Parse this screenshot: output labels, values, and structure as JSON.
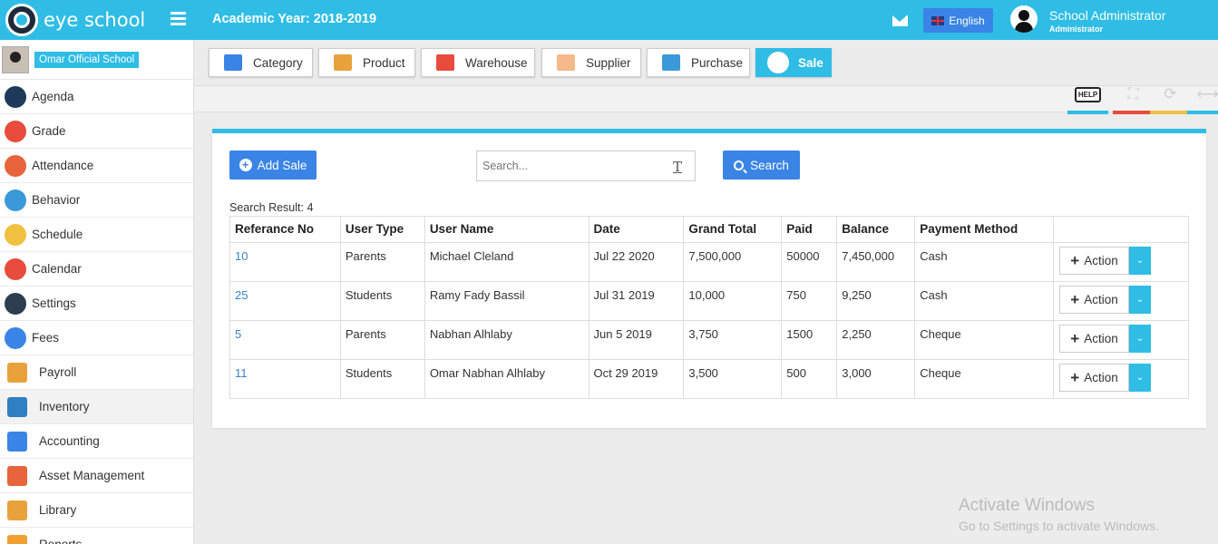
{
  "header": {
    "logo_text": "eye school",
    "academic_year": "Academic Year: 2018-2019",
    "language": "English",
    "user_name": "School Administrator",
    "user_role": "Administrator",
    "accent": "#2fbde6"
  },
  "sidebar": {
    "school_name": "Omar Official School",
    "items": [
      {
        "label": "Agenda",
        "icon": "agenda-icon",
        "color": "#1e3a5a"
      },
      {
        "label": "Grade",
        "icon": "grade-icon",
        "color": "#e74c3c"
      },
      {
        "label": "Attendance",
        "icon": "attendance-icon",
        "color": "#e8643c"
      },
      {
        "label": "Behavior",
        "icon": "behavior-icon",
        "color": "#3a9ad9"
      },
      {
        "label": "Schedule",
        "icon": "schedule-icon",
        "color": "#f0c040"
      },
      {
        "label": "Calendar",
        "icon": "calendar-icon",
        "color": "#e74c3c"
      },
      {
        "label": "Settings",
        "icon": "settings-icon",
        "color": "#2c3e50"
      },
      {
        "label": "Fees",
        "icon": "fees-icon",
        "color": "#3a84e6"
      },
      {
        "label": "Payroll",
        "icon": "payroll-icon",
        "color": "#e8a23c"
      },
      {
        "label": "Inventory",
        "icon": "inventory-icon",
        "color": "#2f7fc1"
      },
      {
        "label": "Accounting",
        "icon": "accounting-icon",
        "color": "#3a84e6"
      },
      {
        "label": "Asset Management",
        "icon": "asset-management-icon",
        "color": "#e8643c"
      },
      {
        "label": "Library",
        "icon": "library-icon",
        "color": "#e8a23c"
      },
      {
        "label": "Reports",
        "icon": "reports-icon",
        "color": "#f0a030"
      }
    ]
  },
  "tabs": [
    {
      "label": "Category",
      "icon": "category-icon",
      "color": "#3a84e6"
    },
    {
      "label": "Product",
      "icon": "product-icon",
      "color": "#e8a23c"
    },
    {
      "label": "Warehouse",
      "icon": "warehouse-icon",
      "color": "#e74c3c"
    },
    {
      "label": "Supplier",
      "icon": "supplier-icon",
      "color": "#f5b98a"
    },
    {
      "label": "Purchase",
      "icon": "purchase-icon",
      "color": "#3a9ad9"
    },
    {
      "label": "Sale",
      "icon": "sale-icon",
      "color": "#ffffff"
    }
  ],
  "tools": {
    "help": "HELP",
    "colors": [
      "#2fbde6",
      "#e74c3c",
      "#f0c040",
      "#2fbde6"
    ]
  },
  "main": {
    "add_button": "Add Sale",
    "search_placeholder": "Search...",
    "search_button": "Search",
    "result_text": "Search Result: 4",
    "columns": [
      "Referance No",
      "User Type",
      "User Name",
      "Date",
      "Grand Total",
      "Paid",
      "Balance",
      "Payment Method",
      ""
    ],
    "rows": [
      [
        "10",
        "Parents",
        "Michael Cleland",
        "Jul 22 2020",
        "7,500,000",
        "50000",
        "7,450,000",
        "Cash"
      ],
      [
        "25",
        "Students",
        "Ramy Fady Bassil",
        "Jul 31 2019",
        "10,000",
        "750",
        "9,250",
        "Cash"
      ],
      [
        "5",
        "Parents",
        "Nabhan Alhlaby",
        "Jun 5 2019",
        "3,750",
        "1500",
        "2,250",
        "Cheque"
      ],
      [
        "11",
        "Students",
        "Omar Nabhan Alhlaby",
        "Oct 29 2019",
        "3,500",
        "500",
        "3,000",
        "Cheque"
      ]
    ],
    "action_label": "Action"
  },
  "watermark": {
    "line1": "Activate Windows",
    "line2": "Go to Settings to activate Windows."
  }
}
